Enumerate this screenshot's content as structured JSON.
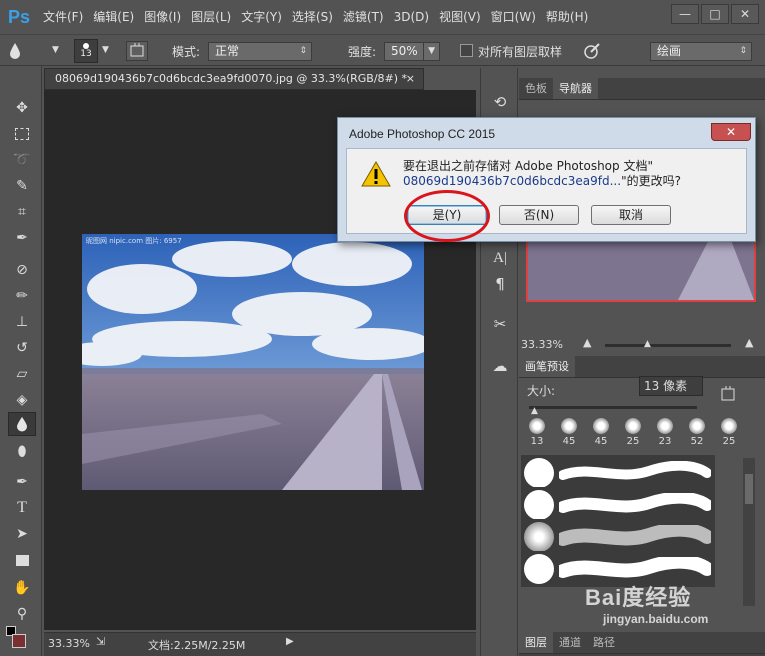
{
  "app": {
    "logo": "Ps"
  },
  "menu": [
    "文件(F)",
    "编辑(E)",
    "图像(I)",
    "图层(L)",
    "文字(Y)",
    "选择(S)",
    "滤镜(T)",
    "3D(D)",
    "视图(V)",
    "窗口(W)",
    "帮助(H)"
  ],
  "window_controls": {
    "minimize": "—",
    "maximize": "□",
    "close": "✕"
  },
  "options": {
    "brush_size": "13",
    "mode_label": "模式:",
    "mode_value": "正常",
    "strength_label": "强度:",
    "strength_value": "50%",
    "sample_all_label": "对所有图层取样",
    "workspace_value": "绘画"
  },
  "document": {
    "tab_title": "08069d190436b7c0d6bcdc3ea9fd0070.jpg @ 33.3%(RGB/8#) *",
    "tab_close": "×",
    "photo_watermark": "昵图网 nipic.com  图片: 6957",
    "zoom": "33.33%",
    "doc_size": "文档:2.25M/2.25M"
  },
  "nav_panel": {
    "tabs": [
      "色板",
      "导航器"
    ],
    "zoom": "33.33%"
  },
  "brush_panel": {
    "title": "画笔预设",
    "size_label": "大小:",
    "size_value": "13 像素",
    "tips": [
      "13",
      "45",
      "45",
      "25",
      "23",
      "52",
      "25"
    ]
  },
  "layers_tabs": [
    "图层",
    "通道",
    "路径"
  ],
  "dialog": {
    "title": "Adobe Photoshop CC 2015",
    "close": "✕",
    "message_line1": "要在退出之前存储对 Adobe Photoshop 文档\"",
    "message_line2_file": "08069d190436b7c0d6bcdc3ea9fd...",
    "message_line2_suffix": "\"的更改吗?",
    "buttons": {
      "yes": "是(Y)",
      "no": "否(N)",
      "cancel": "取消"
    }
  },
  "watermark": {
    "brand": "Bai度经验",
    "url": "jingyan.baidu.com"
  },
  "colors": {
    "annotation_red": "#d9141a",
    "ps_blue": "#3aa0e8",
    "nav_frame": "#e04040"
  }
}
